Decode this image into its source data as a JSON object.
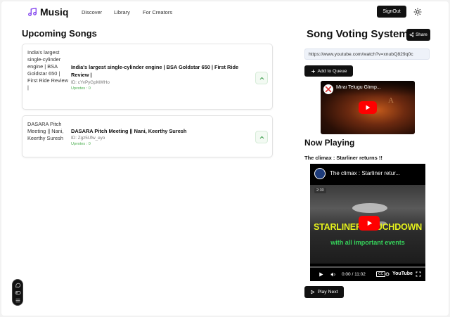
{
  "nav": {
    "brand": "Musiq",
    "links": [
      "Discover",
      "Library",
      "For Creators"
    ],
    "signout_label": "SignOut"
  },
  "upcoming": {
    "title": "Upcoming Songs",
    "songs": [
      {
        "thumb_alt": "India's largest single-cylinder engine | BSA Goldstar 650 | First Ride Review |",
        "title": "India's largest single-cylinder engine | BSA Goldstar 650 | First Ride Review |",
        "id_text": "ID: cYvPyGpMWHo",
        "upvotes_text": "Upvotes : 0"
      },
      {
        "thumb_alt": "DASARA Pitch Meeting || Nani, Keerthy Suresh",
        "title": "DASARA Pitch Meeting || Nani, Keerthy Suresh",
        "id_text": "ID: Zgz5Ufw_eyo",
        "upvotes_text": "Upvotes : 0"
      }
    ]
  },
  "voting": {
    "title": "Song Voting System",
    "share_label": "Share",
    "url_value": "https://www.youtube.com/watch?v=xnubQ829q0c",
    "add_label": "Add to Queue",
    "preview_title": "Mirai Telugu Glimp...",
    "preview_channel_text": "A"
  },
  "now_playing": {
    "heading": "Now Playing",
    "song_title": "The climax : Starliner returns !!",
    "video_title": "The climax : Starliner retur...",
    "badge_time": "2:30",
    "overlay_line1": "STARLINER TOUCHDOWN",
    "overlay_line2": "with all important events",
    "time": "0:00 / 11:02",
    "cc": "CC",
    "yt_logo": "YouTube",
    "play_next_label": "Play Next"
  },
  "colors": {
    "accent": "#111111",
    "brand_purple": "#7c3aed",
    "upvote_green": "#4caf50",
    "yt_red": "#ff0000",
    "overlay_yellow": "#e6f21c",
    "overlay_green": "#35d25a"
  },
  "icons": {
    "brand": "music-note-icon",
    "theme": "sun-icon",
    "share": "share-icon",
    "add": "plus-icon",
    "upvote": "chevron-up-icon",
    "play_next": "play-icon"
  }
}
